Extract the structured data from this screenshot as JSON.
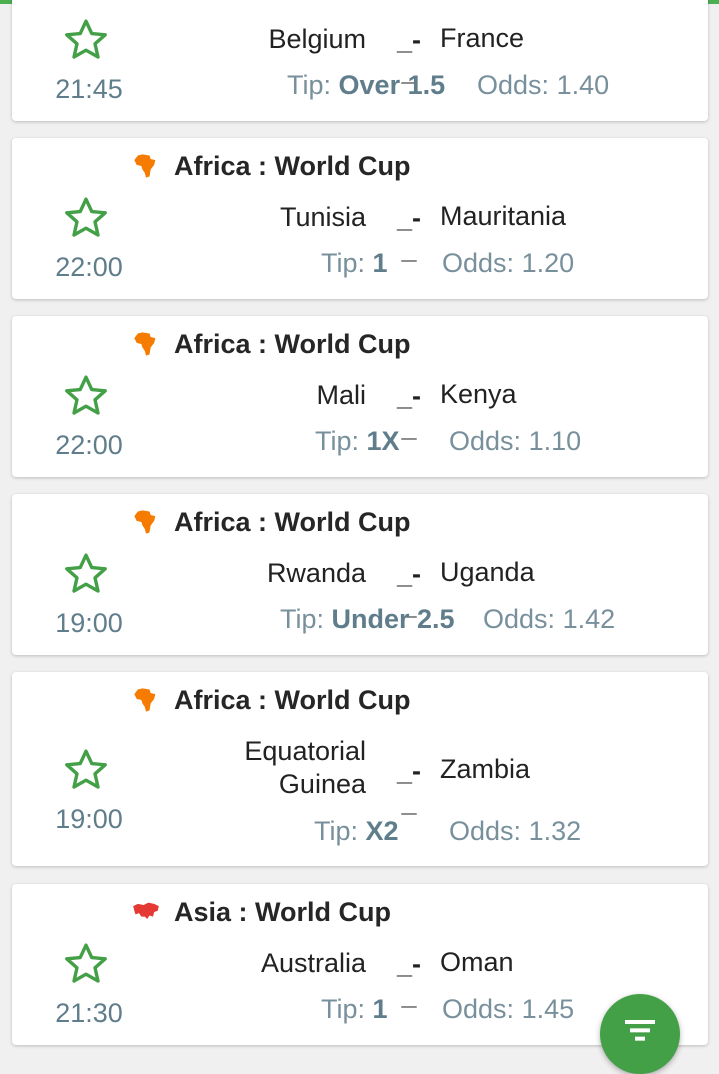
{
  "colors": {
    "accent": "#4caf50",
    "fab": "#43a047",
    "tip_text": "#78909c",
    "africa": "#f57c00",
    "asia": "#e53935"
  },
  "labels": {
    "tip": "Tip:",
    "odds": "Odds:",
    "separator": "_-_"
  },
  "matches": [
    {
      "league": "",
      "league_icon": "",
      "home": "Belgium",
      "away": "France",
      "time": "21:45",
      "tip": "Over 1.5",
      "odds": "1.40"
    },
    {
      "league": "Africa : World Cup",
      "league_icon": "africa-map-icon",
      "home": "Tunisia",
      "away": "Mauritania",
      "time": "22:00",
      "tip": "1",
      "odds": "1.20"
    },
    {
      "league": "Africa : World Cup",
      "league_icon": "africa-map-icon",
      "home": "Mali",
      "away": "Kenya",
      "time": "22:00",
      "tip": "1X",
      "odds": "1.10"
    },
    {
      "league": "Africa : World Cup",
      "league_icon": "africa-map-icon",
      "home": "Rwanda",
      "away": "Uganda",
      "time": "19:00",
      "tip": "Under 2.5",
      "odds": "1.42"
    },
    {
      "league": "Africa : World Cup",
      "league_icon": "africa-map-icon",
      "home_line1": "Equatorial",
      "home_line2": "Guinea",
      "away": "Zambia",
      "time": "19:00",
      "tip": "X2",
      "odds": "1.32"
    },
    {
      "league": "Asia : World Cup",
      "league_icon": "asia-map-icon",
      "home": "Australia",
      "away": "Oman",
      "time": "21:30",
      "tip": "1",
      "odds": "1.45"
    }
  ],
  "fab": {
    "icon": "filter-icon"
  }
}
